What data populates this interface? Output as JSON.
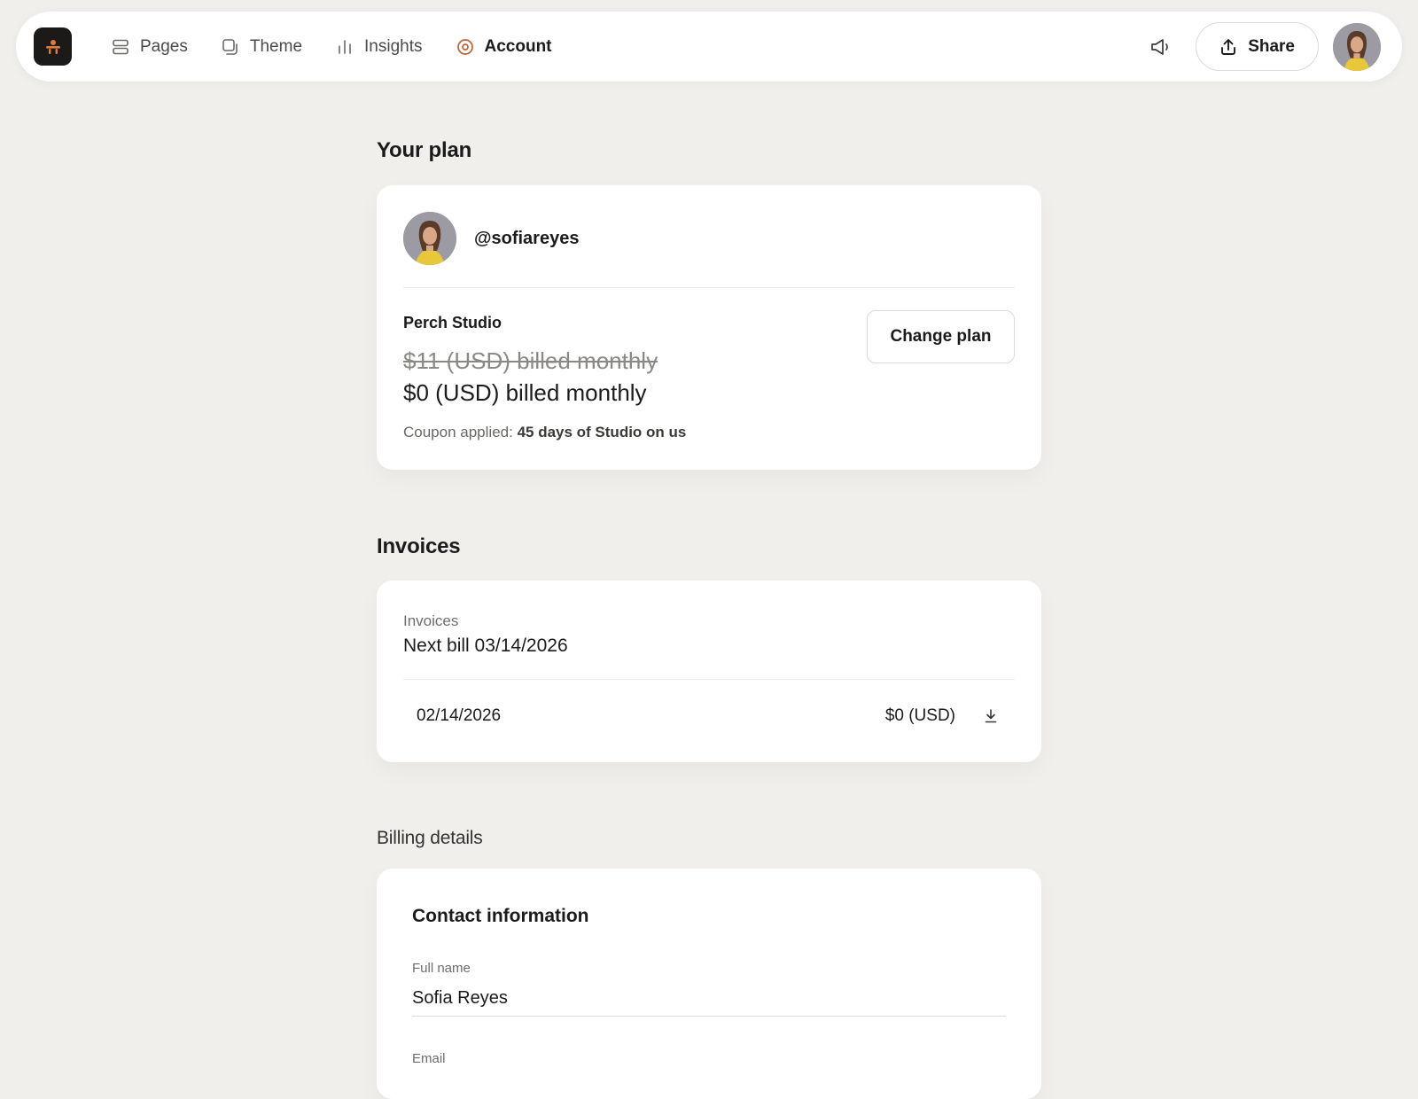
{
  "nav": {
    "items": [
      {
        "label": "Pages",
        "icon": "pages-icon"
      },
      {
        "label": "Theme",
        "icon": "theme-icon"
      },
      {
        "label": "Insights",
        "icon": "insights-icon"
      },
      {
        "label": "Account",
        "icon": "account-icon",
        "active": true
      }
    ],
    "share_label": "Share",
    "accent_color": "#c0622f"
  },
  "plan": {
    "section_title": "Your plan",
    "handle": "@sofiareyes",
    "plan_name": "Perch Studio",
    "old_price": "$11 (USD) billed monthly",
    "new_price": "$0 (USD) billed monthly",
    "coupon_prefix": "Coupon applied:",
    "coupon_value": "45 days of Studio on us",
    "change_plan_label": "Change plan"
  },
  "invoices": {
    "section_title": "Invoices",
    "label": "Invoices",
    "next_bill": "Next bill 03/14/2026",
    "rows": [
      {
        "date": "02/14/2026",
        "amount": "$0 (USD)"
      }
    ]
  },
  "billing": {
    "section_title": "Billing details",
    "contact_title": "Contact information",
    "full_name_label": "Full name",
    "full_name_value": "Sofia Reyes",
    "email_label": "Email"
  }
}
